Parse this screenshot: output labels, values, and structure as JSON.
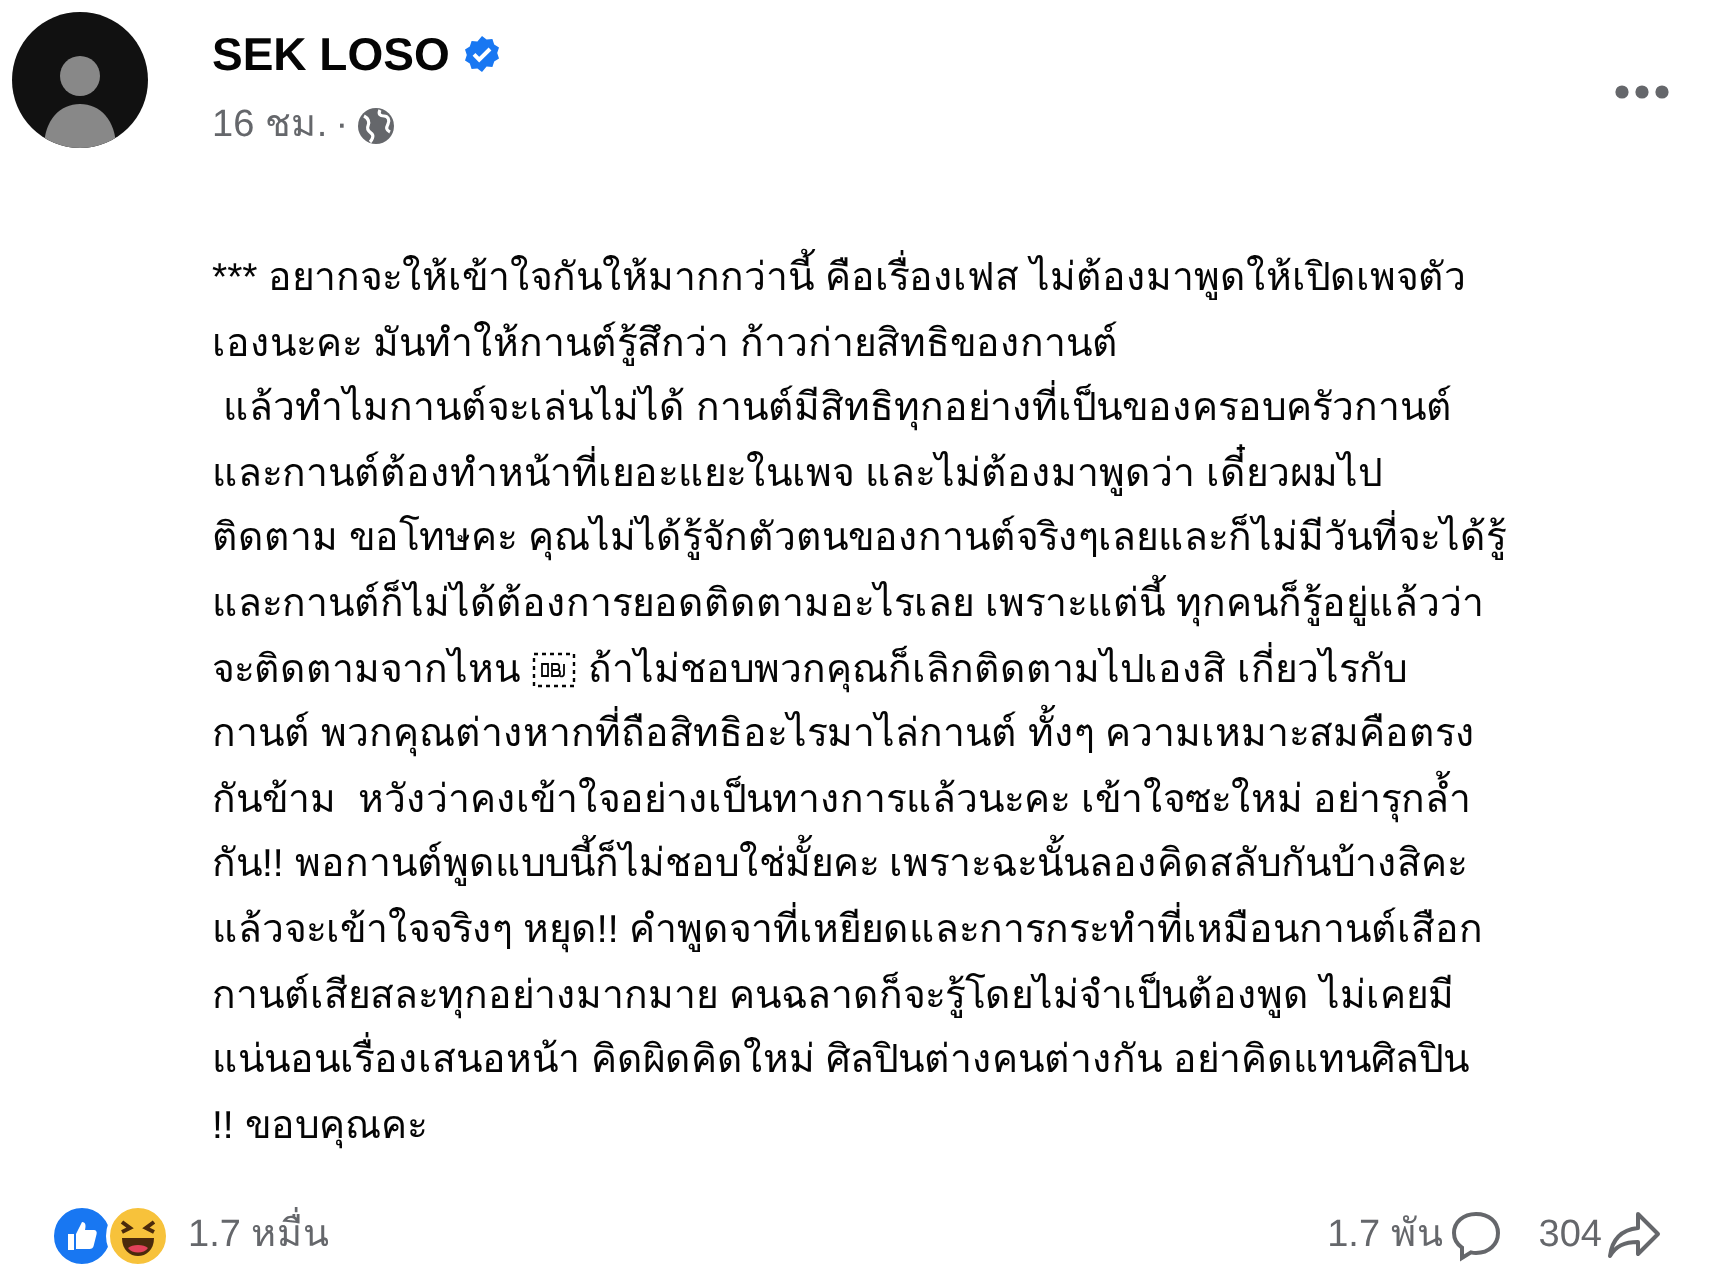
{
  "post": {
    "author": "SEK LOSO",
    "verified": true,
    "time": "16 ชม.",
    "separator": "·",
    "blocks": [
      {
        "kind": "text",
        "lines": [
          "*** อยากจะให้เข้าใจกันให้มากกว่านี้ คือเรื่องเฟส ไม่ต้องมาพูดให้เปิดเพจตัว",
          "เองนะคะ มันทำให้กานต์รู้สึกว่า ก้าวก่ายสิทธิของกานต์",
          " แล้วทำไมกานต์จะเล่นไม่ได้ กานต์มีสิทธิทุกอย่างที่เป็นของครอบครัวกานต์",
          "และกานต์ต้องทำหน้าที่เยอะแยะในเพจ และไม่ต้องมาพูดว่า เดี๋ยวผมไป",
          "ติดตาม ขอโทษคะ คุณไม่ได้รู้จักตัวตนของกานต์จริงๆเลยและก็ไม่มีวันที่จะได้รู้",
          "และกานต์ก็ไม่ได้ต้องการยอดติดตามอะไรเลย เพราะแต่นี้ ทุกคนก็รู้อยู่แล้วว่า"
        ]
      },
      {
        "kind": "line",
        "parts": [
          {
            "kind": "text",
            "text": "จะติดตามจากไหน"
          },
          {
            "kind": "object-glyph"
          },
          {
            "kind": "text",
            "text": "ถ้าไม่ชอบพวกคุณก็เลิกติดตามไปเองสิ เกี่ยวไรกับ"
          }
        ]
      },
      {
        "kind": "text",
        "lines": [
          "กานต์ พวกคุณต่างหากที่ถือสิทธิอะไรมาไล่กานต์ ทั้งๆ ความเหมาะสมคือตรง",
          "กันข้าม  หวังว่าคงเข้าใจอย่างเป็นทางการแล้วนะคะ เข้าใจซะใหม่ อย่ารุกล้ำ",
          "กัน!! พอกานต์พูดแบบนี้ก็ไม่ชอบใช่มั้ยคะ เพราะฉะนั้นลองคิดสลับกันบ้างสิคะ",
          "แล้วจะเข้าใจจริงๆ หยุด!! คำพูดจาที่เหยียดและการกระทำที่เหมือนกานต์เสือก",
          "กานต์เสียสละทุกอย่างมากมาย คนฉลาดก็จะรู้โดยไม่จำเป็นต้องพูด ไม่เคยมี",
          "แน่นอนเรื่องเสนอหน้า คิดผิดคิดใหม่ ศิลปินต่างคนต่างกัน อย่าคิดแทนศิลปิน",
          "!! ขอบคุณคะ"
        ]
      }
    ]
  },
  "footer": {
    "reactions_count": "1.7 หมื่น",
    "comments_count": "1.7 พัน",
    "shares_count": "304"
  }
}
